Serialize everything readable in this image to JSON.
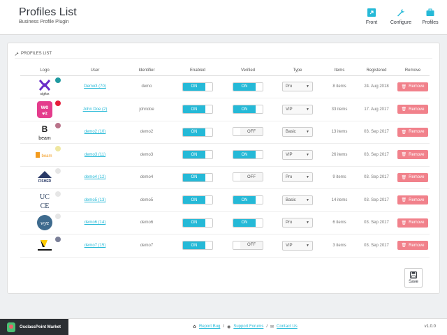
{
  "header": {
    "title": "Profiles List",
    "subtitle": "Business Profile Plugin",
    "tools": [
      {
        "label": "Front",
        "icon": "external-link-icon"
      },
      {
        "label": "Configure",
        "icon": "wrench-icon"
      },
      {
        "label": "Profiles",
        "icon": "briefcase-icon"
      }
    ]
  },
  "panel": {
    "title": "PROFILES LIST",
    "columns": [
      "Logo",
      "User",
      "Identifier",
      "Enabled",
      "Verified",
      "Type",
      "Items",
      "Registered",
      "Remove"
    ],
    "remove_label": "Remove",
    "save_label": "Save"
  },
  "rows": [
    {
      "logo": "sigfox",
      "user": "Demo3 (70)",
      "identifier": "demo",
      "enabled": "ON",
      "verified": "ON",
      "type": "Pro",
      "items": "8 items",
      "registered": "24. Aug 2018",
      "dot": "#1f9aa0"
    },
    {
      "logo": "we it",
      "user": "John Doe (2)",
      "identifier": "johndoe",
      "enabled": "ON",
      "verified": "ON",
      "type": "VIP",
      "items": "33 items",
      "registered": "17. Aug 2017",
      "dot": "#e51c3a"
    },
    {
      "logo": "beam",
      "user": "demo2 (10)",
      "identifier": "demo2",
      "enabled": "ON",
      "verified": "OFF",
      "type": "Basic",
      "items": "13 items",
      "registered": "03. Sep 2017",
      "dot": "#b9738a"
    },
    {
      "logo": "beam",
      "user": "demo3 (11)",
      "identifier": "demo3",
      "enabled": "ON",
      "verified": "ON",
      "type": "VIP",
      "items": "26 items",
      "registered": "03. Sep 2017",
      "dot": "#efe7a0"
    },
    {
      "logo": "FISHER",
      "user": "demo4 (12)",
      "identifier": "demo4",
      "enabled": "ON",
      "verified": "OFF",
      "type": "Pro",
      "items": "9 items",
      "registered": "03. Sep 2017",
      "dot": "#e6e6e6"
    },
    {
      "logo": "UCCE",
      "user": "demo5 (13)",
      "identifier": "demo5",
      "enabled": "ON",
      "verified": "ON",
      "type": "Basic",
      "items": "14 items",
      "registered": "03. Sep 2017",
      "dot": "#e6e6e6"
    },
    {
      "logo": "wyz",
      "user": "demo6 (14)",
      "identifier": "demo6",
      "enabled": "ON",
      "verified": "ON",
      "type": "Pro",
      "items": "6 items",
      "registered": "03. Sep 2017",
      "dot": "#e6e6e6"
    },
    {
      "logo": "cba",
      "user": "demo7 (15)",
      "identifier": "demo7",
      "enabled": "ON",
      "verified": "OFF",
      "type": "VIP",
      "items": "3 items",
      "registered": "03. Sep 2017",
      "dot": "#7a7f98"
    }
  ],
  "footer": {
    "brand": "OsclassPoint Market",
    "links": [
      "Report Bug",
      "Support Forums",
      "Contact Us"
    ],
    "version": "v1.0.0"
  }
}
